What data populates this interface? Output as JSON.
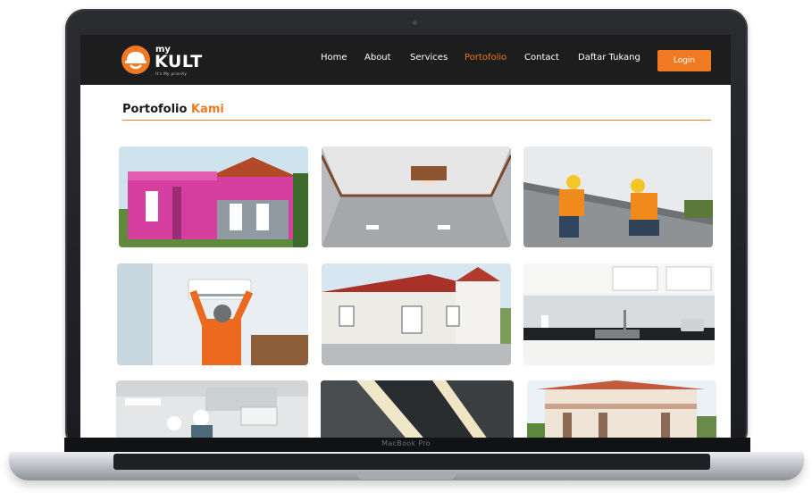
{
  "device": {
    "model_label": "MacBook Pro"
  },
  "site": {
    "logo": {
      "prefix": "my",
      "name": "KULT",
      "tagline": "It's My priority"
    },
    "nav": {
      "items": [
        {
          "label": "Home",
          "active": false
        },
        {
          "label": "About",
          "active": false
        },
        {
          "label": "Services",
          "active": false
        },
        {
          "label": "Portofolio",
          "active": true
        },
        {
          "label": "Contact",
          "active": false
        },
        {
          "label": "Daftar Tukang",
          "active": false
        }
      ],
      "login_label": "Login"
    },
    "section": {
      "title_main": "Portofolio",
      "title_accent": "Kami"
    },
    "gallery": [
      {
        "subject": "pink house",
        "icon": "pink-house-photo"
      },
      {
        "subject": "ceiling interior",
        "icon": "ceiling-photo"
      },
      {
        "subject": "roof workers",
        "icon": "roof-workers-photo"
      },
      {
        "subject": "ac technician",
        "icon": "ac-technician-photo"
      },
      {
        "subject": "white houses",
        "icon": "white-houses-photo"
      },
      {
        "subject": "kitchen",
        "icon": "kitchen-photo"
      },
      {
        "subject": "ac installation",
        "icon": "ac-installation-photo"
      },
      {
        "subject": "ceiling lighting",
        "icon": "ceiling-lighting-photo"
      },
      {
        "subject": "two story house",
        "icon": "two-story-house-photo"
      }
    ]
  },
  "colors": {
    "accent": "#f07a21",
    "navbar": "#1d1d1d"
  }
}
